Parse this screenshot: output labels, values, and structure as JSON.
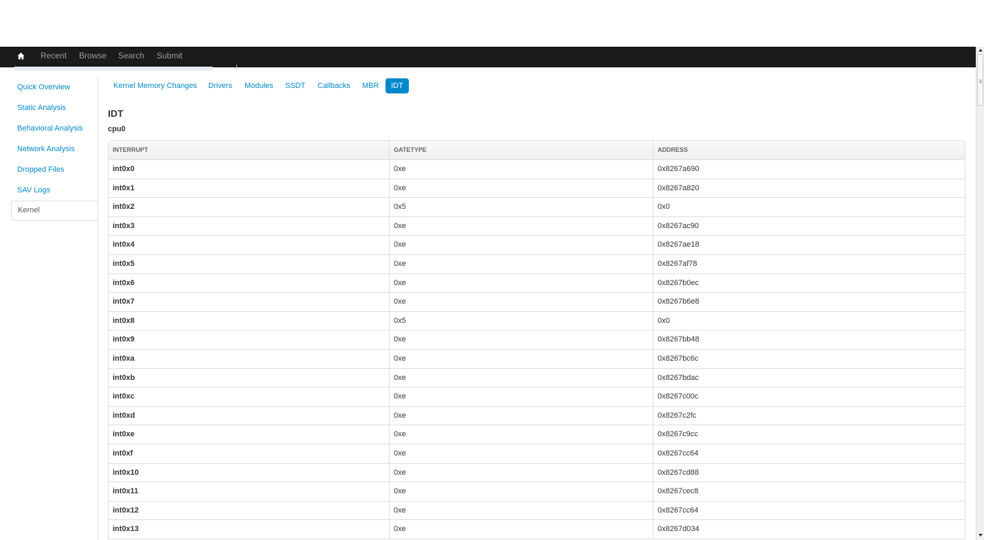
{
  "navbar": {
    "items": [
      {
        "label": "Recent"
      },
      {
        "label": "Browse"
      },
      {
        "label": "Search"
      },
      {
        "label": "Submit"
      }
    ]
  },
  "sidebar": {
    "items": [
      {
        "label": "Quick Overview"
      },
      {
        "label": "Static Analysis"
      },
      {
        "label": "Behavioral Analysis"
      },
      {
        "label": "Network Analysis"
      },
      {
        "label": "Dropped Files"
      },
      {
        "label": "SAV Logs"
      },
      {
        "label": "Kernel",
        "active": true
      }
    ]
  },
  "tabs": [
    {
      "label": "Kernel Memory Changes"
    },
    {
      "label": "Drivers"
    },
    {
      "label": "Modules"
    },
    {
      "label": "SSDT"
    },
    {
      "label": "Callbacks"
    },
    {
      "label": "MBR"
    },
    {
      "label": "IDT",
      "active": true
    }
  ],
  "section": {
    "title": "IDT",
    "subtitle": "cpu0"
  },
  "table": {
    "headers": [
      "INTERRUPT",
      "GATETYPE",
      "ADDRESS"
    ],
    "rows": [
      [
        "int0x0",
        "0xe",
        "0x8267a690"
      ],
      [
        "int0x1",
        "0xe",
        "0x8267a820"
      ],
      [
        "int0x2",
        "0x5",
        "0x0"
      ],
      [
        "int0x3",
        "0xe",
        "0x8267ac90"
      ],
      [
        "int0x4",
        "0xe",
        "0x8267ae18"
      ],
      [
        "int0x5",
        "0xe",
        "0x8267af78"
      ],
      [
        "int0x6",
        "0xe",
        "0x8267b0ec"
      ],
      [
        "int0x7",
        "0xe",
        "0x8267b6e8"
      ],
      [
        "int0x8",
        "0x5",
        "0x0"
      ],
      [
        "int0x9",
        "0xe",
        "0x8267bb48"
      ],
      [
        "int0xa",
        "0xe",
        "0x8267bc6c"
      ],
      [
        "int0xb",
        "0xe",
        "0x8267bdac"
      ],
      [
        "int0xc",
        "0xe",
        "0x8267c00c"
      ],
      [
        "int0xd",
        "0xe",
        "0x8267c2fc"
      ],
      [
        "int0xe",
        "0xe",
        "0x8267c9cc"
      ],
      [
        "int0xf",
        "0xe",
        "0x8267cc64"
      ],
      [
        "int0x10",
        "0xe",
        "0x8267cd88"
      ],
      [
        "int0x11",
        "0xe",
        "0x8267cec8"
      ],
      [
        "int0x12",
        "0xe",
        "0x8267cc64"
      ],
      [
        "int0x13",
        "0xe",
        "0x8267d034"
      ]
    ]
  },
  "colors": {
    "navbar_bg": "#1b1b1b",
    "link": "#0088cc",
    "active_pill_bg": "#0088cc",
    "border": "#dddddd"
  },
  "icons": {
    "home": "home-icon"
  }
}
